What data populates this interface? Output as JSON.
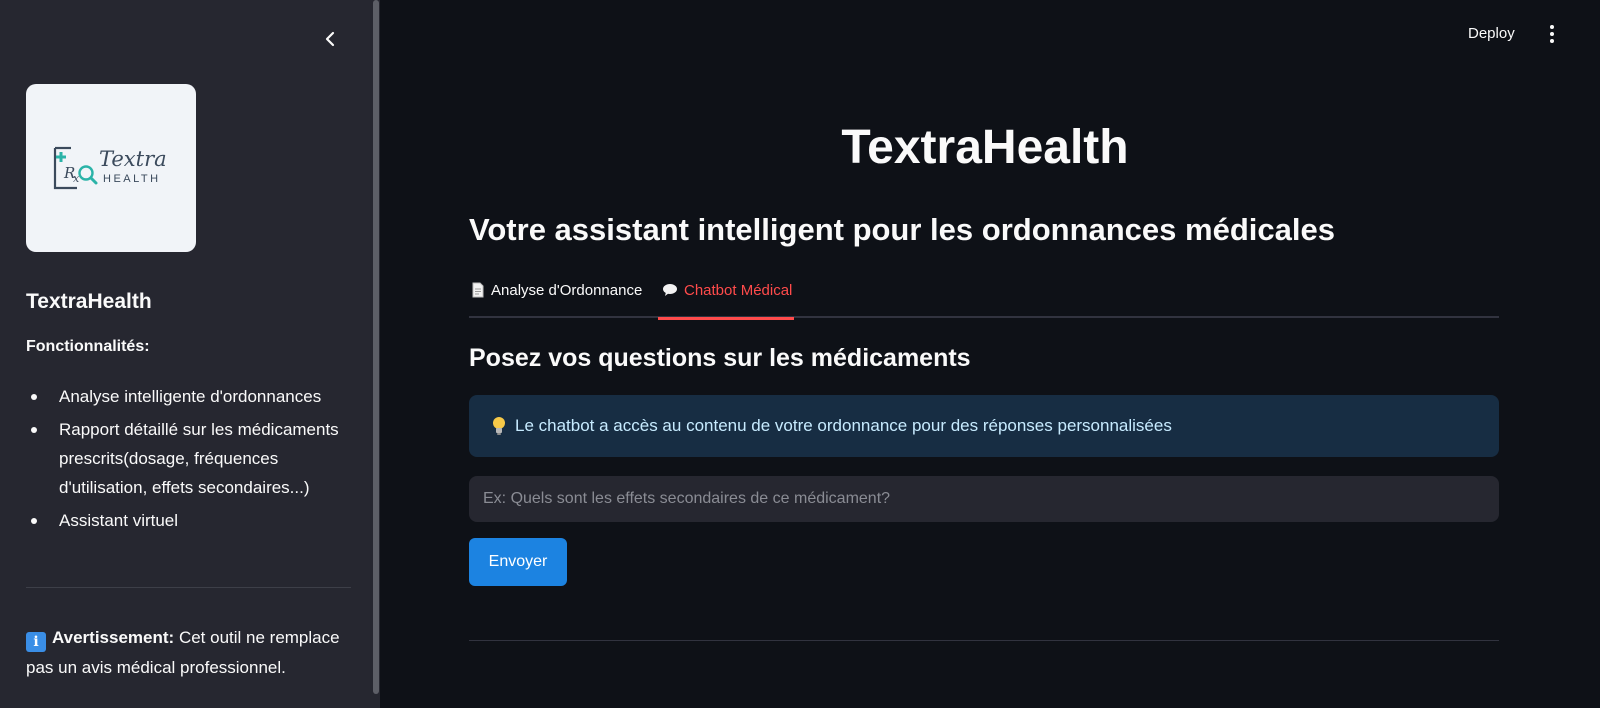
{
  "header": {
    "deploy_label": "Deploy"
  },
  "sidebar": {
    "logo_text_1": "Textra",
    "logo_text_2": "HEALTH",
    "title": "TextraHealth",
    "features_label": "Fonctionnalités:",
    "features": [
      "Analyse intelligente d'ordonnances",
      "Rapport détaillé sur les médicaments prescrits(dosage, fréquences d'utilisation, effets secondaires...)",
      "Assistant virtuel"
    ],
    "warning_label": "Avertissement:",
    "warning_text": "Cet outil ne remplace pas un avis médical professionnel."
  },
  "main": {
    "title": "TextraHealth",
    "subtitle": "Votre assistant intelligent pour les ordonnances médicales",
    "tabs": [
      {
        "label": "Analyse d'Ordonnance",
        "active": false
      },
      {
        "label": "Chatbot Médical",
        "active": true
      }
    ],
    "section_title": "Posez vos questions sur les médicaments",
    "info_text": "Le chatbot a accès au contenu de votre ordonnance pour des réponses personnalisées",
    "input_placeholder": "Ex: Quels sont les effets secondaires de ce médicament?",
    "input_value": "",
    "send_label": "Envoyer"
  },
  "colors": {
    "accent": "#ff4b4b",
    "primary_button": "#1c83e1",
    "background": "#0e1117",
    "sidebar": "#262730"
  }
}
